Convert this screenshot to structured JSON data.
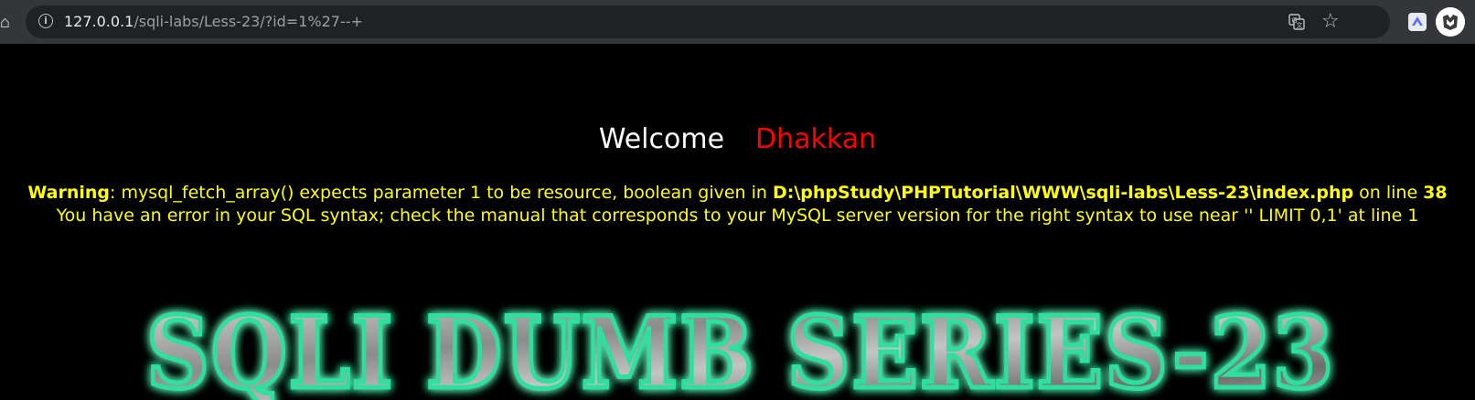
{
  "browser": {
    "url_host": "127.0.0.1",
    "url_path": "/sqli-labs/Less-23/?id=1%27--+",
    "icons": {
      "home": "home-icon",
      "info": "info-icon",
      "translate": "translate-icon",
      "bookmark": "star-icon",
      "extension": "extension-icon",
      "profile": "profile-icon"
    }
  },
  "page": {
    "welcome_word": "Welcome",
    "welcome_name": "Dhakkan",
    "warning_label": "Warning",
    "warning_text": ": mysql_fetch_array() expects parameter 1 to be resource, boolean given in ",
    "warning_path": "D:\\phpStudy\\PHPTutorial\\WWW\\sqli-labs\\Less-23\\index.php",
    "warning_line_prefix": " on line ",
    "warning_line_number": "38",
    "error_text": "You have an error in your SQL syntax; check the manual that corresponds to your MySQL server version for the right syntax to use near '' LIMIT 0,1' at line 1",
    "banner_text": "SQLI DUMB SERIES-23"
  },
  "colors": {
    "background": "#000000",
    "welcome": "#ffffff",
    "name": "#ff0000",
    "warning": "#ffff00",
    "banner_glow": "#2fe0a0"
  }
}
